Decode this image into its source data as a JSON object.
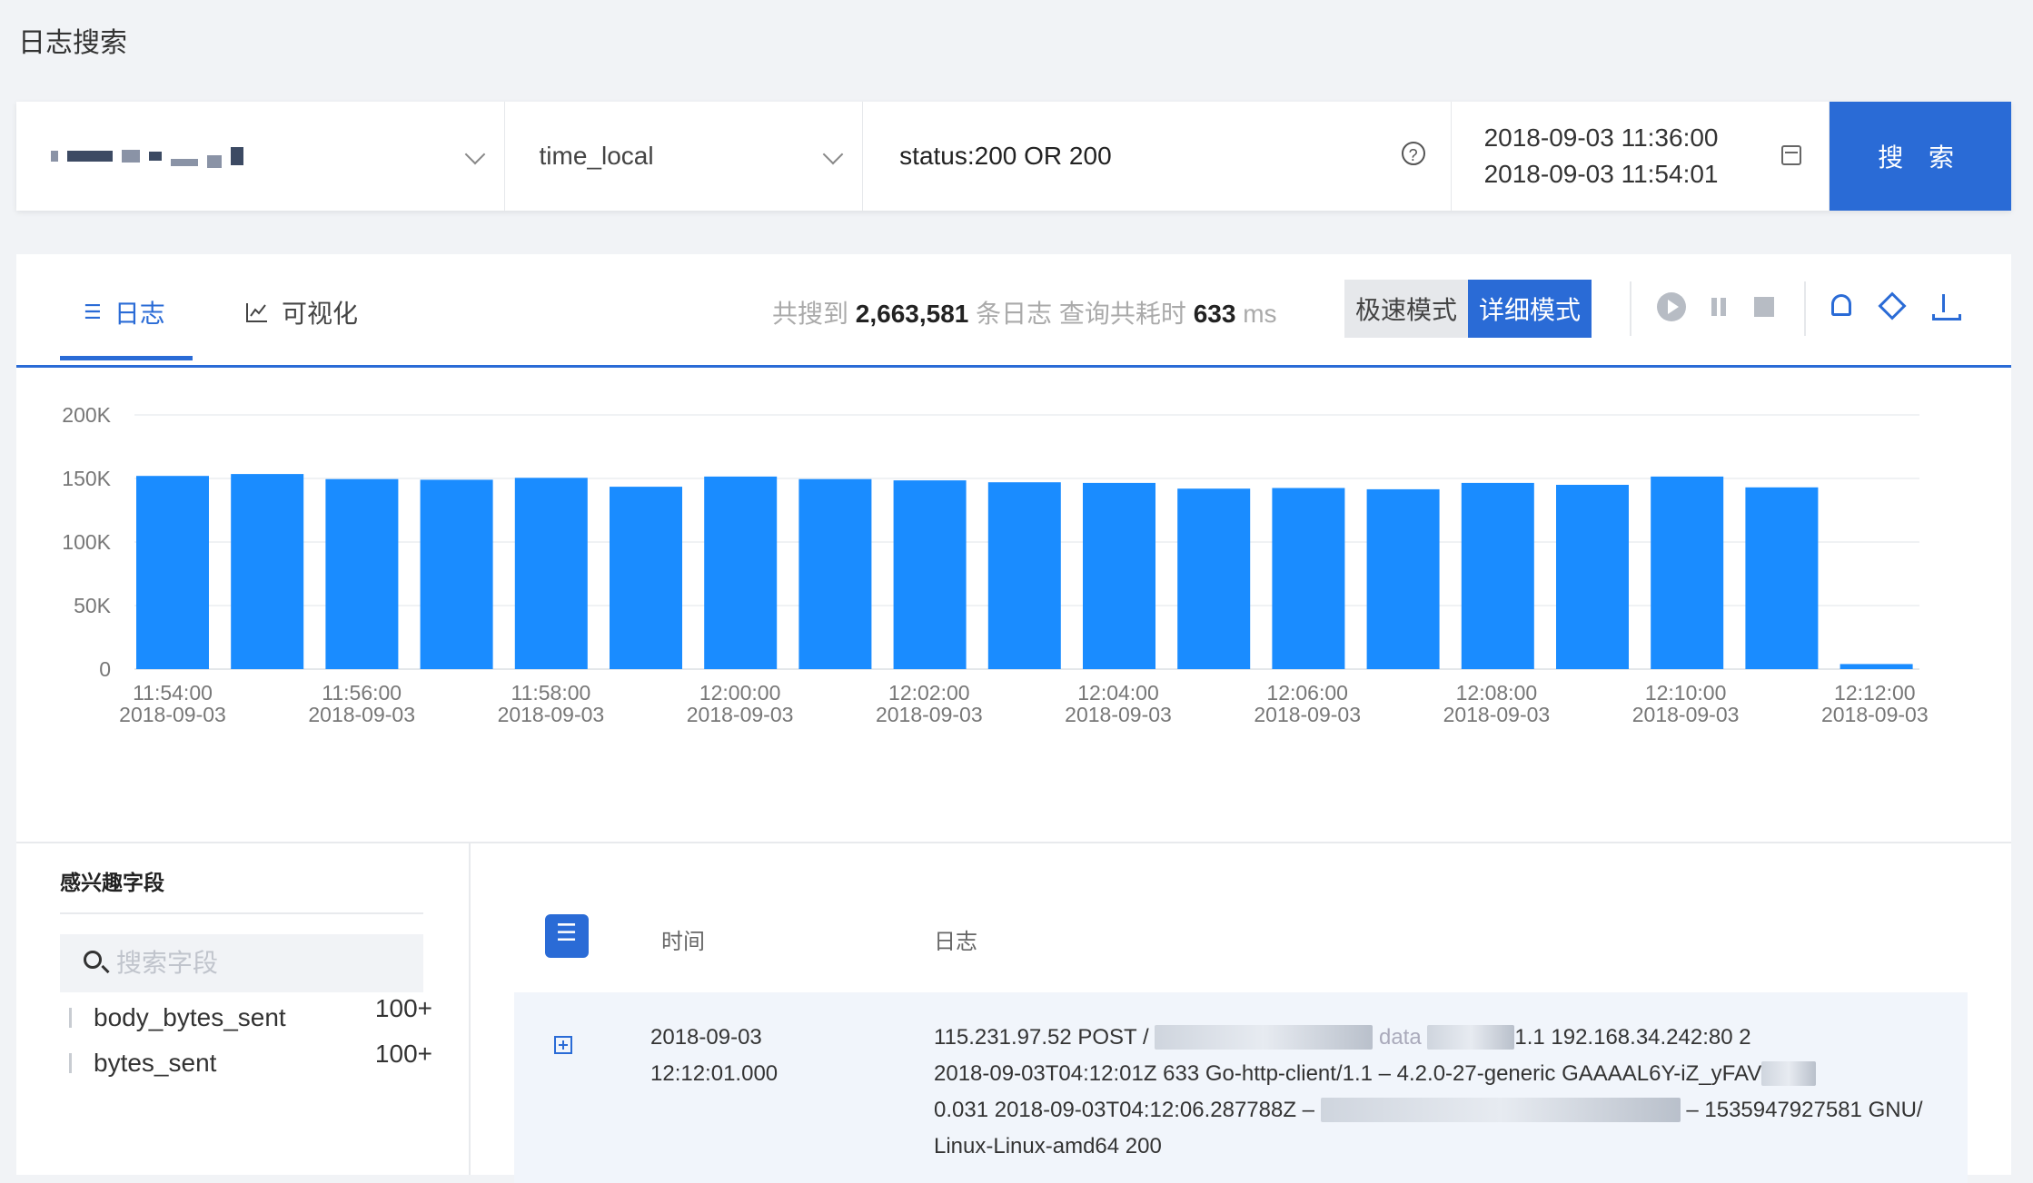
{
  "page": {
    "title": "日志搜索"
  },
  "search": {
    "field": "time_local",
    "query": "status:200 OR 200",
    "time_start": "2018-09-03 11:36:00",
    "time_end": "2018-09-03 11:54:01",
    "button": "搜 索"
  },
  "tabs": {
    "log": "日志",
    "visual": "可视化"
  },
  "stats": {
    "prefix": "共搜到",
    "count": "2,663,581",
    "mid": "条日志 查询共耗时",
    "ms": "633",
    "unit": "ms"
  },
  "modes": {
    "fast": "极速模式",
    "detail": "详细模式"
  },
  "chart_data": {
    "type": "bar",
    "y_ticks": [
      "0",
      "50K",
      "100K",
      "150K",
      "200K"
    ],
    "ylim": [
      0,
      200000
    ],
    "values": [
      152000,
      153500,
      149500,
      149000,
      150500,
      143500,
      151500,
      149500,
      148500,
      147000,
      146500,
      142000,
      142500,
      141500,
      146500,
      145000,
      151500,
      143000,
      4000
    ],
    "x_ticks": [
      {
        "time": "11:54:00",
        "date": "2018-09-03"
      },
      {
        "time": "11:56:00",
        "date": "2018-09-03"
      },
      {
        "time": "11:58:00",
        "date": "2018-09-03"
      },
      {
        "time": "12:00:00",
        "date": "2018-09-03"
      },
      {
        "time": "12:02:00",
        "date": "2018-09-03"
      },
      {
        "time": "12:04:00",
        "date": "2018-09-03"
      },
      {
        "time": "12:06:00",
        "date": "2018-09-03"
      },
      {
        "time": "12:08:00",
        "date": "2018-09-03"
      },
      {
        "time": "12:10:00",
        "date": "2018-09-03"
      },
      {
        "time": "12:12:00",
        "date": "2018-09-03"
      }
    ],
    "bar_color": "#1a8cff",
    "grid": true
  },
  "fields": {
    "title": "感兴趣字段",
    "search_placeholder": "搜索字段",
    "items": [
      {
        "name": "body_bytes_sent",
        "count": "100+"
      },
      {
        "name": "bytes_sent",
        "count": "100+"
      }
    ]
  },
  "table": {
    "col_time": "时间",
    "col_log": "日志",
    "rows": [
      {
        "date": "2018-09-03",
        "time": "12:12:01.000",
        "line1_a": "115.231.97.52 POST /",
        "line1_b": "data",
        "line1_c": "1.1 192.168.34.242:80 2",
        "line2_a": "2018-09-03T04:12:01Z 633 Go-http-client/1.1 – 4.2.0-27-generic GAAAAL6Y-iZ_yFAV",
        "line3_a": "0.031 2018-09-03T04:12:06.287788Z –",
        "line3_b": "– 1535947927581 GNU/",
        "line4_a": "Linux-Linux-amd64 200"
      }
    ]
  }
}
